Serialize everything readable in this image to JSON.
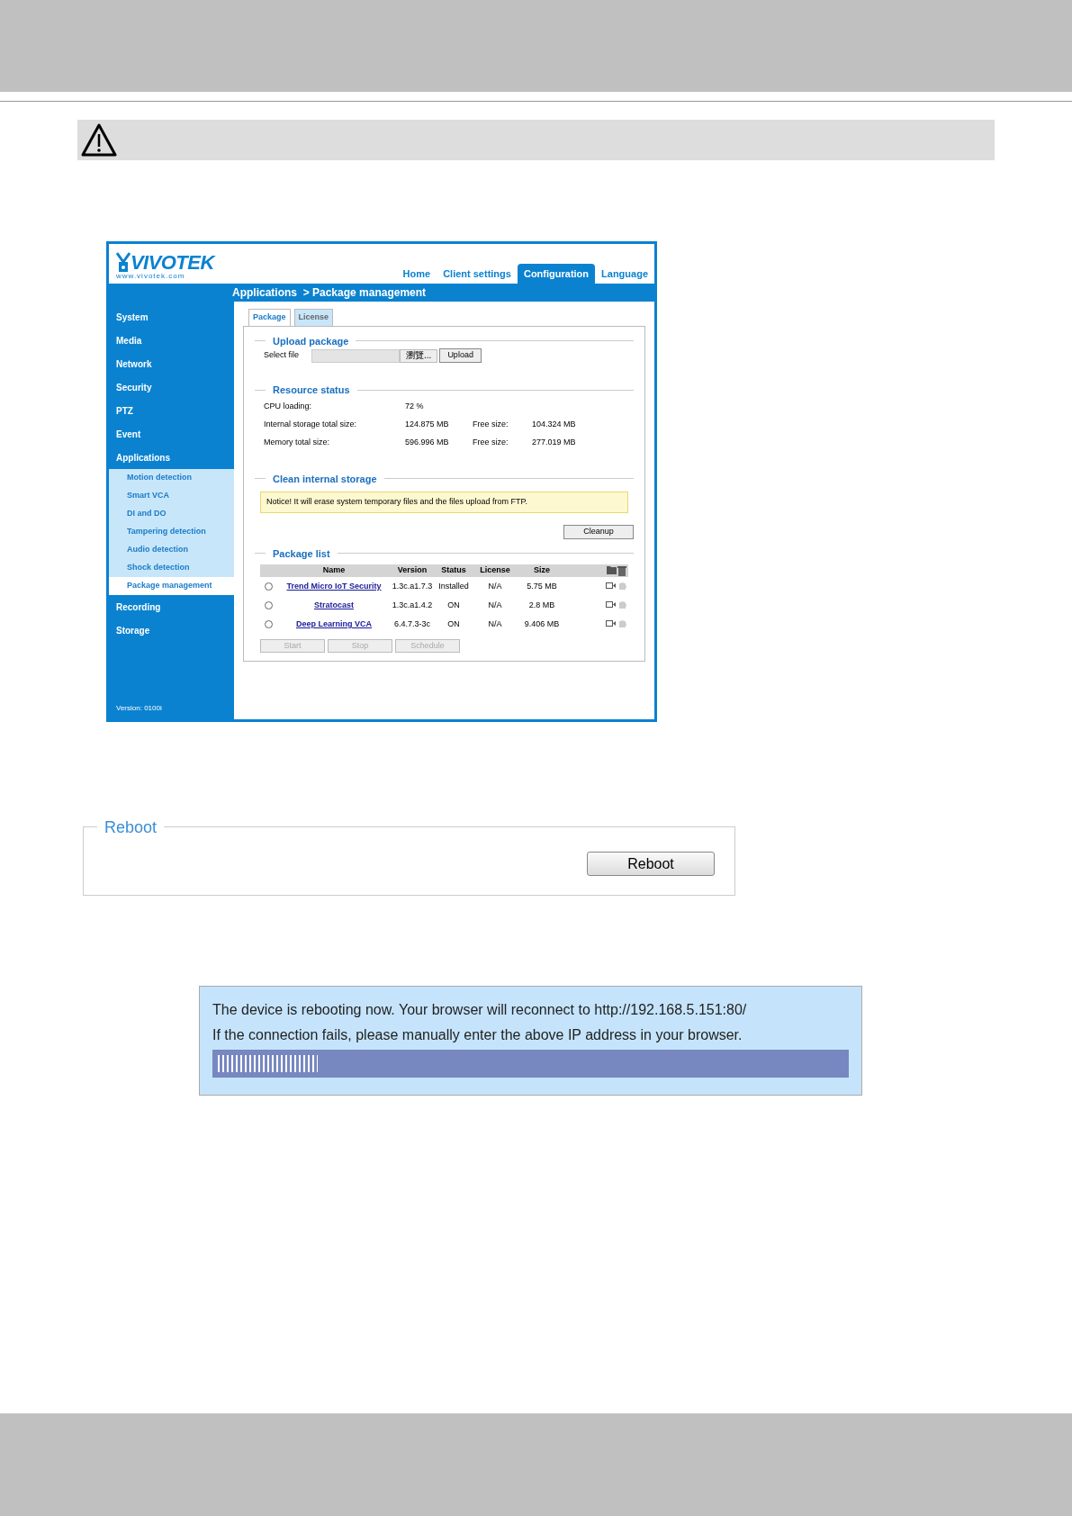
{
  "app": {
    "logo": "VIVOTEK",
    "logo_url": "www.vivotek.com",
    "nav": [
      {
        "label": "Home",
        "selected": false
      },
      {
        "label": "Client settings",
        "selected": false
      },
      {
        "label": "Configuration",
        "selected": true
      },
      {
        "label": "Language",
        "selected": false
      }
    ],
    "breadcrumb": "Applications  > Package management",
    "sidebar": [
      {
        "label": "System"
      },
      {
        "label": "Media"
      },
      {
        "label": "Network"
      },
      {
        "label": "Security"
      },
      {
        "label": "PTZ"
      },
      {
        "label": "Event"
      },
      {
        "label": "Applications",
        "children": [
          {
            "label": "Motion detection",
            "selected": false
          },
          {
            "label": "Smart VCA",
            "selected": false
          },
          {
            "label": "DI and DO",
            "selected": false
          },
          {
            "label": "Tampering detection",
            "selected": false
          },
          {
            "label": "Audio detection",
            "selected": false
          },
          {
            "label": "Shock detection",
            "selected": false
          },
          {
            "label": "Package management",
            "selected": true
          }
        ]
      },
      {
        "label": "Recording"
      },
      {
        "label": "Storage"
      }
    ],
    "version": "Version: 0100i",
    "tabs": [
      {
        "label": "Package",
        "selected": true
      },
      {
        "label": "License",
        "selected": false
      }
    ],
    "upload": {
      "title": "Upload package",
      "label": "Select file",
      "browse": "瀏覽...",
      "button": "Upload"
    },
    "resource": {
      "title": "Resource status",
      "rows": [
        {
          "label": "CPU loading:",
          "value": "72 %"
        },
        {
          "label": "Internal storage total size:",
          "value": "124.875 MB",
          "free_label": "Free size:",
          "free": "104.324 MB"
        },
        {
          "label": "Memory total size:",
          "value": "596.996 MB",
          "free_label": "Free size:",
          "free": "277.019 MB"
        }
      ]
    },
    "clean": {
      "title": "Clean internal storage",
      "notice": "Notice! It will erase system temporary files and the files upload from FTP.",
      "button": "Cleanup"
    },
    "packages": {
      "title": "Package list",
      "columns": [
        "Name",
        "Version",
        "Status",
        "License",
        "Size"
      ],
      "rows": [
        {
          "name": "Trend Micro IoT Security",
          "version": "1.3c.a1.7.3",
          "status": "Installed",
          "license": "N/A",
          "size": "5.75 MB",
          "selected": false
        },
        {
          "name": "Stratocast",
          "version": "1.3c.a1.4.2",
          "status": "ON",
          "license": "N/A",
          "size": "2.8 MB",
          "selected": false
        },
        {
          "name": "Deep Learning VCA",
          "version": "6.4.7.3-3c",
          "status": "ON",
          "license": "N/A",
          "size": "9.406 MB",
          "selected": false
        }
      ],
      "buttons": [
        {
          "label": "Start",
          "disabled": true
        },
        {
          "label": "Stop",
          "disabled": true
        },
        {
          "label": "Schedule",
          "disabled": true
        }
      ]
    }
  },
  "reboot": {
    "title": "Reboot",
    "button": "Reboot"
  },
  "rebooting": {
    "lines": [
      "The device is rebooting now. Your browser will reconnect to http://192.168.5.151:80/",
      "If the connection fails, please manually enter the above IP address in your browser."
    ],
    "level": 0.16
  }
}
